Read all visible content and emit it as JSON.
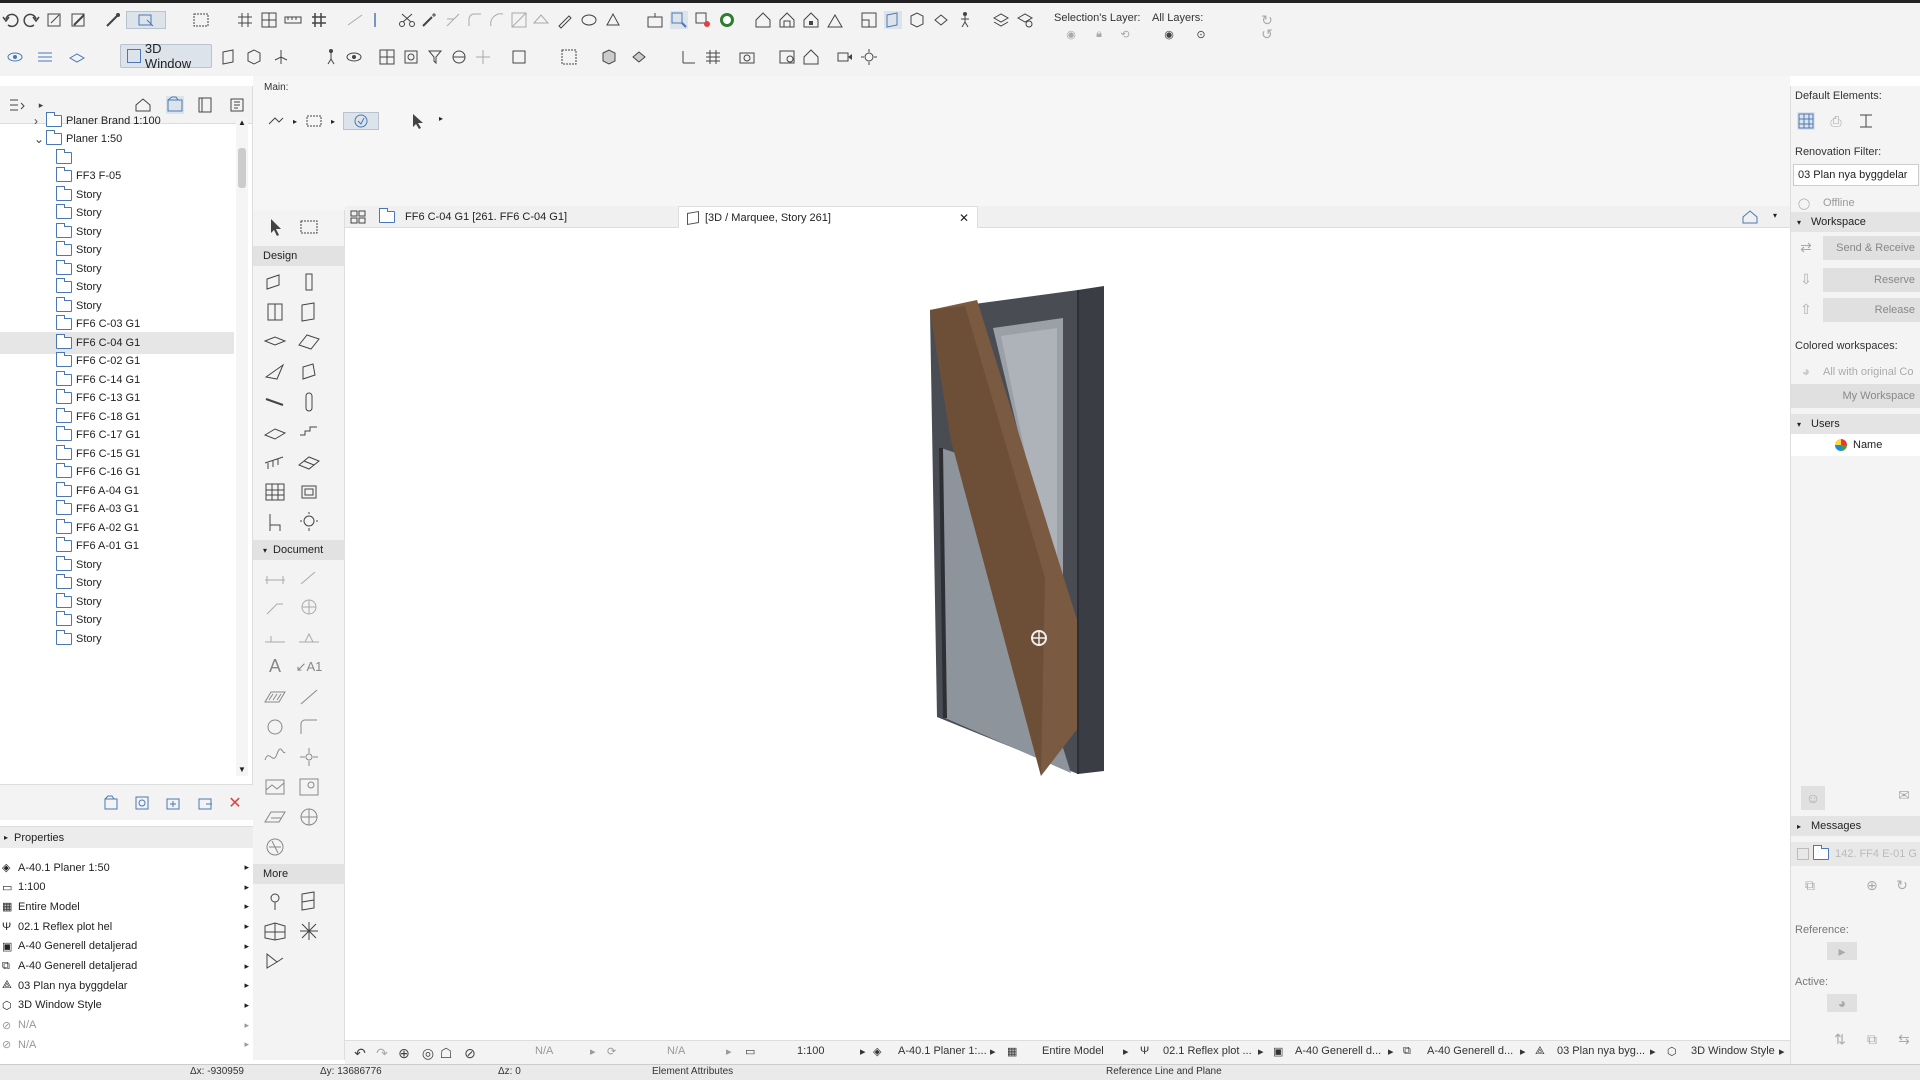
{
  "top_toolbar": {
    "selection_layer_label": "Selection's Layer:",
    "all_layers_label": "All Layers:"
  },
  "second_toolbar": {
    "window_3d_label": "3D Window"
  },
  "main_toolbar": {
    "label": "Main:"
  },
  "navigator": {
    "items": [
      {
        "label": "Planer Brand 1:100"
      },
      {
        "label": "Planer 1:50"
      },
      {
        "label": ""
      },
      {
        "label": "FF3 F-05"
      },
      {
        "label": "Story"
      },
      {
        "label": "Story"
      },
      {
        "label": "Story"
      },
      {
        "label": "Story"
      },
      {
        "label": "Story"
      },
      {
        "label": "Story"
      },
      {
        "label": "Story"
      },
      {
        "label": "FF6 C-03 G1"
      },
      {
        "label": "FF6 C-04 G1"
      },
      {
        "label": "FF6 C-02 G1"
      },
      {
        "label": "FF6 C-14 G1"
      },
      {
        "label": "FF6 C-13 G1"
      },
      {
        "label": "FF6 C-18 G1"
      },
      {
        "label": "FF6 C-17 G1"
      },
      {
        "label": "FF6 C-15 G1"
      },
      {
        "label": "FF6 C-16 G1"
      },
      {
        "label": "FF6 A-04 G1"
      },
      {
        "label": "FF6 A-03 G1"
      },
      {
        "label": "FF6 A-02 G1"
      },
      {
        "label": "FF6 A-01 G1"
      },
      {
        "label": "Story"
      },
      {
        "label": "Story"
      },
      {
        "label": "Story"
      },
      {
        "label": "Story"
      },
      {
        "label": "Story"
      }
    ],
    "selected_index": 12
  },
  "properties": {
    "header": "Properties",
    "rows": [
      {
        "label": "A-40.1 Planer 1:50"
      },
      {
        "label": "1:100"
      },
      {
        "label": "Entire Model"
      },
      {
        "label": "02.1 Reflex plot hel"
      },
      {
        "label": "A-40 Generell detaljerad"
      },
      {
        "label": "A-40 Generell detaljerad"
      },
      {
        "label": "03 Plan nya byggdelar"
      },
      {
        "label": "3D Window Style"
      },
      {
        "label": "N/A"
      },
      {
        "label": "N/A"
      }
    ]
  },
  "toolbox": {
    "design_label": "Design",
    "document_label": "Document",
    "more_label": "More"
  },
  "tabs": [
    {
      "label": "FF6 C-04 G1 [261. FF6 C-04 G1]"
    },
    {
      "label": "[3D / Marquee, Story 261]"
    }
  ],
  "status_bar": {
    "na1": "N/A",
    "na2": "N/A",
    "scale": "1:100",
    "layer_combo": "A-40.1 Planer 1:...",
    "model": "Entire Model",
    "pen_set": "02.1 Reflex plot ...",
    "mvo": "A-40 Generell d...",
    "graphic_override": "A-40 Generell d...",
    "renovation": "03 Plan nya byg...",
    "style": "3D Window Style"
  },
  "coord_bar": {
    "dx": "Δx: -930959",
    "dy": "Δy: 13686776",
    "dz": "Δz: 0",
    "element_attributes": "Element Attributes",
    "reference": "Reference Line and Plane"
  },
  "right_panel": {
    "default_elements_label": "Default Elements:",
    "renovation_filter_label": "Renovation Filter:",
    "renovation_filter_value": "03 Plan nya byggdelar",
    "offline_label": "Offline",
    "workspace_label": "Workspace",
    "send_receive_label": "Send & Receive",
    "reserve_label": "Reserve",
    "release_label": "Release",
    "colored_workspaces_label": "Colored workspaces:",
    "all_with_original_label": "All with original Co",
    "my_workspace_label": "My Workspace",
    "users_label": "Users",
    "users_name_label": "Name",
    "messages_label": "Messages",
    "message_item_label": "142. FF4 E-01 G",
    "reference_label": "Reference:",
    "active_label": "Active:"
  },
  "colors": {
    "accent": "#4a78b4",
    "frame_dark": "#3b3d44",
    "glass": "#8e949c",
    "leaf": "#7a5a40"
  }
}
